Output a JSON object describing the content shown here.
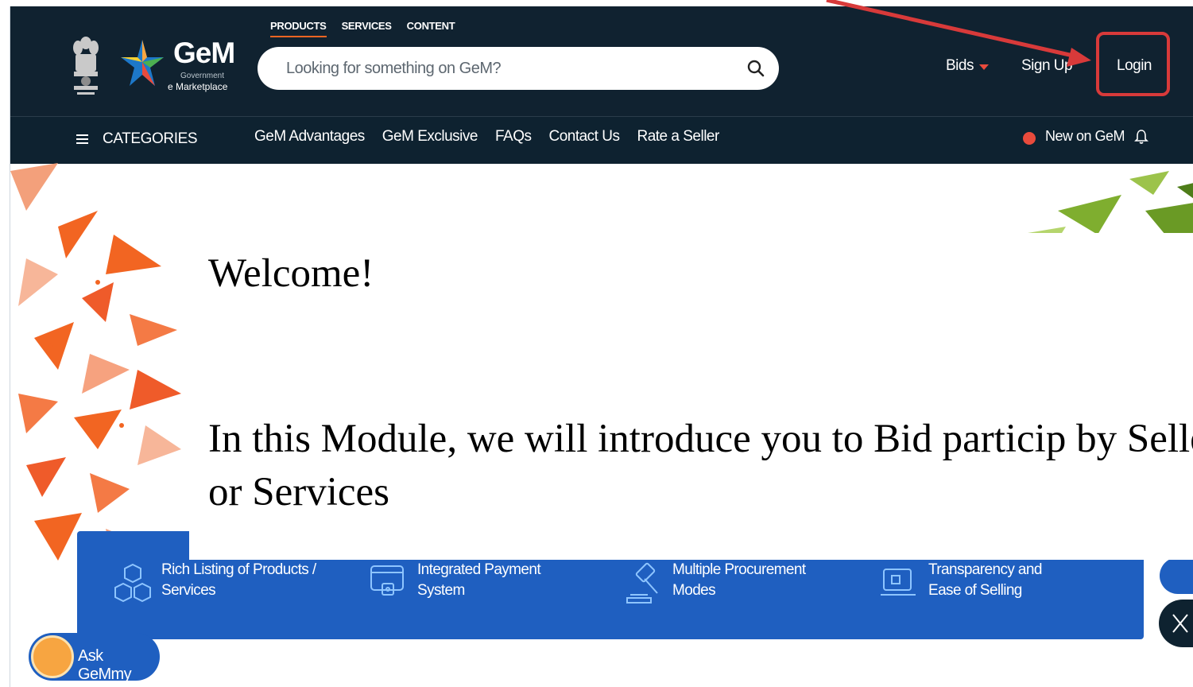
{
  "header": {
    "brand_name": "GeM",
    "brand_sub1": "Government",
    "brand_sub2": "e Marketplace",
    "top_tabs": [
      "PRODUCTS",
      "SERVICES",
      "CONTENT"
    ],
    "search_placeholder": "Looking for something on GeM?",
    "bids_label": "Bids",
    "signup_label": "Sign Up",
    "login_label": "Login"
  },
  "category_bar": {
    "categories_label": "CATEGORIES",
    "links": [
      "GeM Advantages",
      "GeM Exclusive",
      "FAQs",
      "Contact Us",
      "Rate a Seller"
    ],
    "new_on_gem": "New on GeM"
  },
  "overlay": {
    "welcome": "Welcome!",
    "intro": "In this Module, we will introduce you to Bid particip by Seller or Services"
  },
  "features": [
    {
      "line1": "Rich Listing of Products /",
      "line2": "Services",
      "icon": "cubes-icon"
    },
    {
      "line1": "Integrated Payment",
      "line2": "System",
      "icon": "payment-icon"
    },
    {
      "line1": "Multiple Procurement",
      "line2": "Modes",
      "icon": "gavel-icon"
    },
    {
      "line1": "Transparency and",
      "line2": "Ease of Selling",
      "icon": "laptop-icon"
    }
  ],
  "chat": {
    "ask_label": "Ask GeMmy"
  },
  "colors": {
    "header_bg": "#102230",
    "banner_blue": "#1f5fc0",
    "accent_orange": "#f26522",
    "annotation_red": "#d83a3a"
  }
}
